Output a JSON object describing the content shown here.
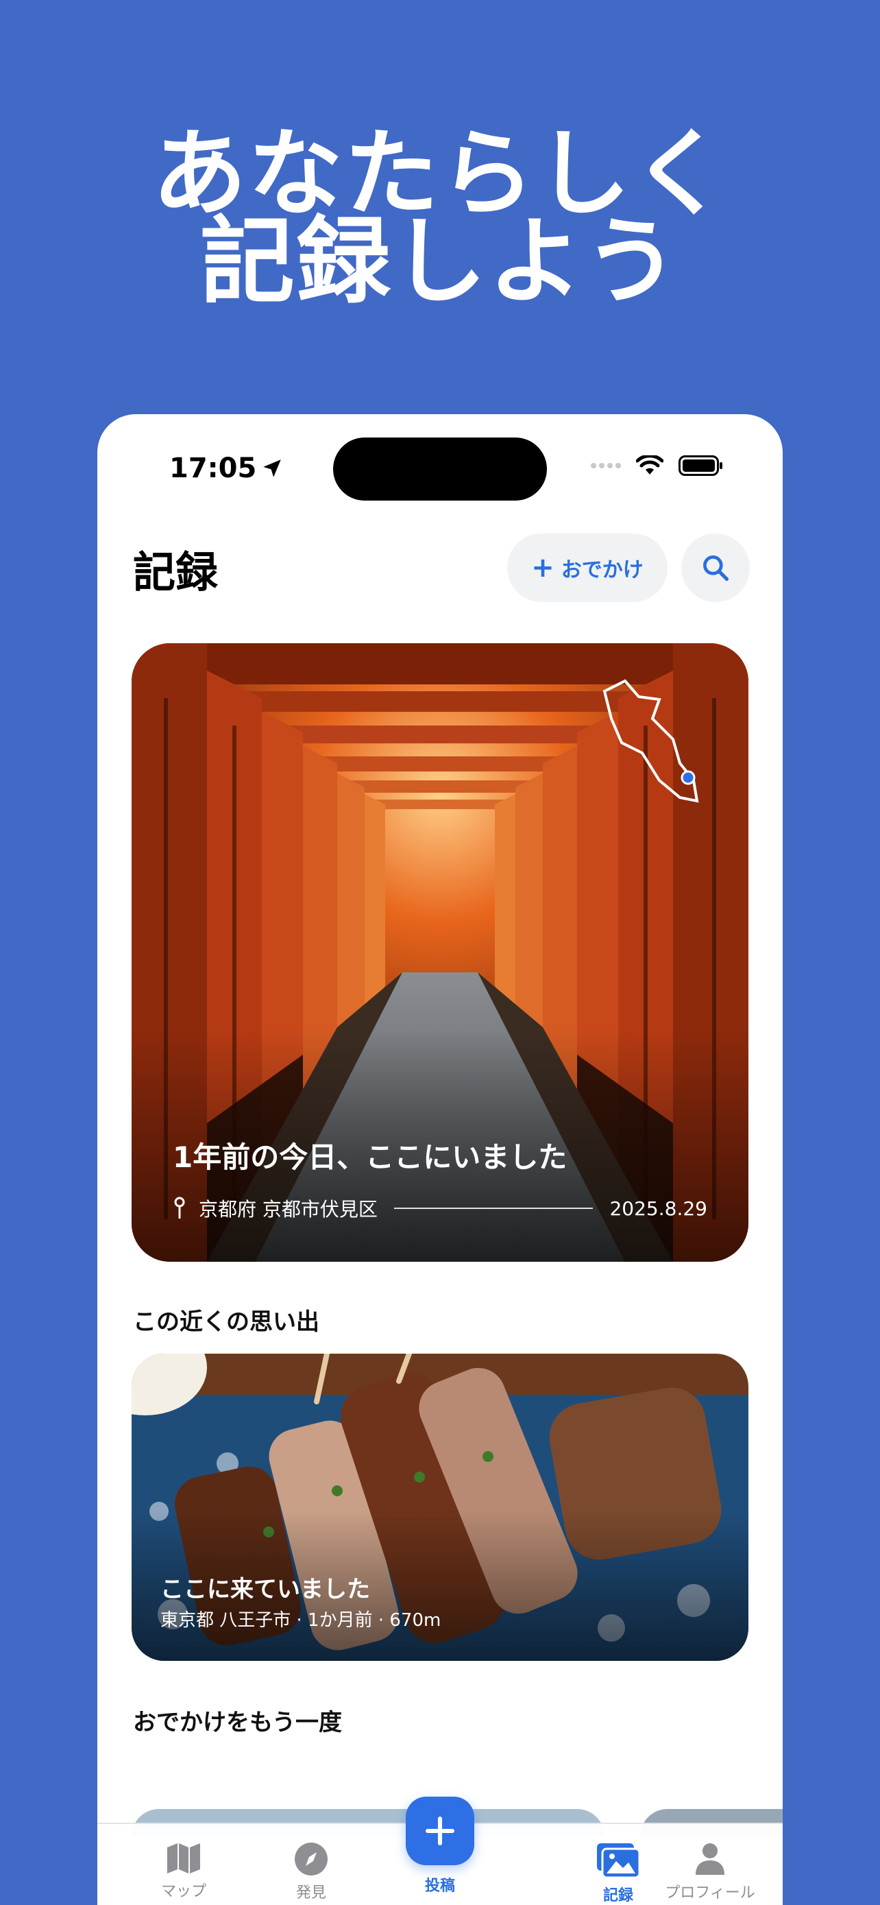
{
  "promo": {
    "line1": "あなたらしく",
    "line2": "記録しよう"
  },
  "status_bar": {
    "time": "17:05"
  },
  "header": {
    "title": "記録",
    "odekake_button": "おでかけ",
    "search_icon": "search-icon"
  },
  "hero": {
    "title": "1年前の今日、ここにいました",
    "location": "京都府 京都市伏見区",
    "date": "2025.8.29"
  },
  "nearby": {
    "section_title": "この近くの思い出",
    "card_title": "ここに来ていました",
    "card_meta": "東京都 八王子市 · 1か月前 · 670m"
  },
  "again": {
    "section_title": "おでかけをもう一度"
  },
  "tabbar": {
    "items": [
      {
        "label": "マップ",
        "icon": "map-icon"
      },
      {
        "label": "発見",
        "icon": "compass-icon"
      },
      {
        "label": "投稿",
        "icon": "plus-icon"
      },
      {
        "label": "記録",
        "icon": "photos-icon"
      },
      {
        "label": "プロフィール",
        "icon": "person-icon"
      }
    ]
  },
  "colors": {
    "background": "#4169c6",
    "accent": "#2a6fe0"
  }
}
